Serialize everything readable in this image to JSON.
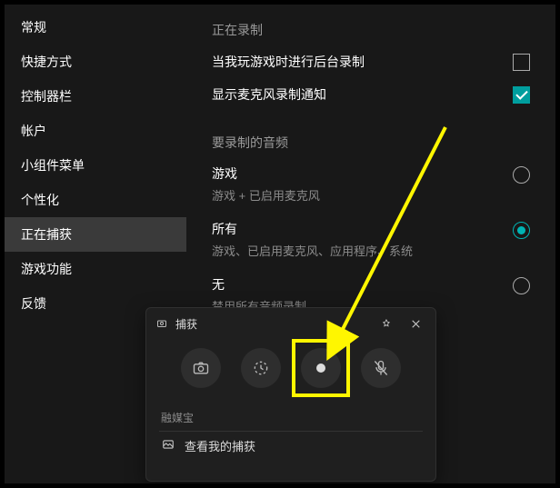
{
  "sidebar": {
    "items": [
      {
        "label": "常规"
      },
      {
        "label": "快捷方式"
      },
      {
        "label": "控制器栏"
      },
      {
        "label": "帐户"
      },
      {
        "label": "小组件菜单"
      },
      {
        "label": "个性化"
      },
      {
        "label": "正在捕获"
      },
      {
        "label": "游戏功能"
      },
      {
        "label": "反馈"
      }
    ],
    "active_index": 6
  },
  "recording": {
    "section_title": "正在录制",
    "background_label": "当我玩游戏时进行后台录制",
    "background_checked": false,
    "mic_label": "显示麦克风录制通知",
    "mic_checked": true
  },
  "audio": {
    "section_title": "要录制的音频",
    "options": [
      {
        "title": "游戏",
        "sub": "游戏 + 已启用麦克风",
        "selected": false
      },
      {
        "title": "所有",
        "sub": "游戏、已启用麦克风、应用程序、系统",
        "selected": true
      },
      {
        "title": "无",
        "sub": "禁用所有音频录制",
        "selected": false
      }
    ]
  },
  "widget": {
    "title": "捕获",
    "section_label": "融媒宝",
    "footer_label": "查看我的捕获",
    "buttons": {
      "screenshot": "screenshot",
      "last30": "record-last-30s",
      "record": "record",
      "mic": "mic-toggle"
    }
  },
  "colors": {
    "accent": "#00b3b3",
    "highlight": "#fff600"
  }
}
